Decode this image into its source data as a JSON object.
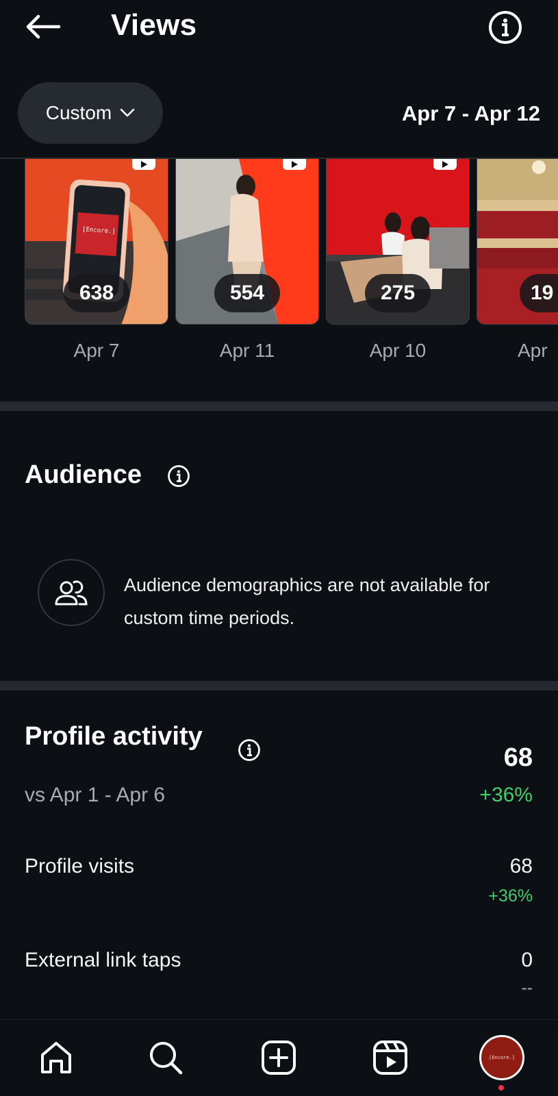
{
  "header": {
    "title": "Views"
  },
  "filter": {
    "preset_label": "Custom",
    "date_range": "Apr 7 - Apr 12"
  },
  "reels": [
    {
      "views": "638",
      "date": "Apr 7",
      "screen_text": "[Encore.]"
    },
    {
      "views": "554",
      "date": "Apr 11"
    },
    {
      "views": "275",
      "date": "Apr 10"
    },
    {
      "views": "19",
      "date": "Apr"
    }
  ],
  "audience": {
    "title": "Audience",
    "message": "Audience demographics are not available for custom time periods."
  },
  "profile_activity": {
    "title": "Profile activity",
    "total": "68",
    "comparison": "vs Apr 1 - Apr 6",
    "change": "+36%",
    "metrics": [
      {
        "label": "Profile visits",
        "value": "68",
        "delta": "+36%"
      },
      {
        "label": "External link taps",
        "value": "0",
        "delta": "--"
      }
    ]
  },
  "nav": {
    "items": [
      "home-icon",
      "search-icon",
      "create-icon",
      "reels-icon",
      "profile-avatar"
    ],
    "profile_text": "[Encore.]"
  },
  "colors": {
    "background": "#0c0f14",
    "positive": "#3ccf6d",
    "brand_red": "#e8262a",
    "muted": "#a7abb2"
  }
}
